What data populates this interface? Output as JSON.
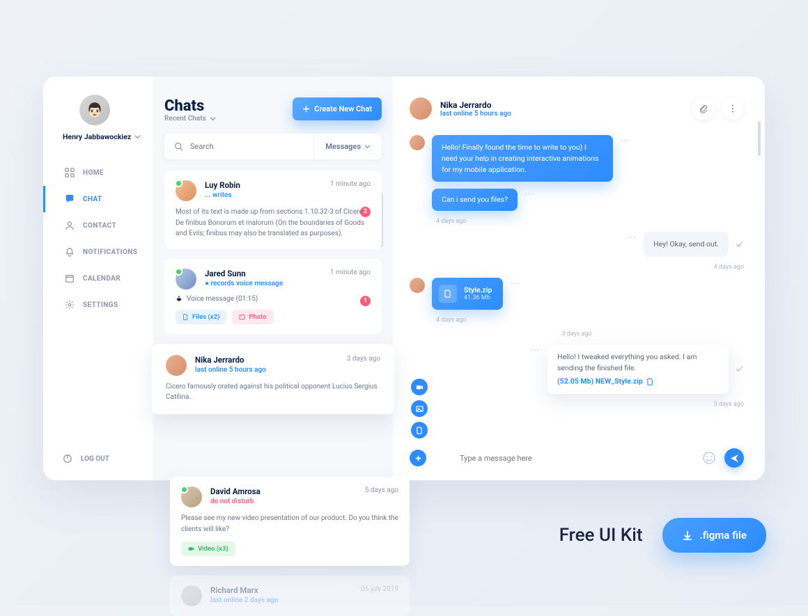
{
  "user": {
    "name": "Henry Jabbawockiez"
  },
  "nav": {
    "home": "HOME",
    "chat": "CHAT",
    "contact": "CONTACT",
    "notifications": "NOTIFICATIONS",
    "calendar": "CALENDAR",
    "settings": "SETTINGS",
    "logout": "LOG OUT"
  },
  "chats": {
    "title": "Chats",
    "recent": "Recent Chats",
    "new_chat": "Create New Chat",
    "search_placeholder": "Search",
    "filter": "Messages"
  },
  "list": {
    "c1": {
      "name": "Luy Robin",
      "status": "... writes",
      "time": "1 minute ago",
      "body": "Most of its text is made up from sections 1.10.32-3 of Cicero's De finibus Bonorum et malorum (On the boundaries of Goods and Evils; finibus may also be translated as purposes).",
      "badge": "2"
    },
    "c2": {
      "name": "Jared Sunn",
      "status": "● records voice message",
      "time": "1 minute ago",
      "voice": "Voice message (01:15)",
      "badge": "1",
      "chip_files": "Files (x2)",
      "chip_photo": "Photo"
    },
    "c3": {
      "name": "Nika Jerrardo",
      "status": "last online 5 hours ago",
      "time": "3 days ago",
      "body": "Cicero famously orated against his political opponent Lucius Sergius Catilina."
    },
    "c4": {
      "name": "David Amrosa",
      "status": "do not disturb",
      "time": "5 days ago",
      "body": "Please see my new video presentation of our product. Do you think the clients will like?",
      "chip_video": "Video (x3)"
    },
    "c5": {
      "name": "Richard Marx",
      "status": "last online 2 days ago",
      "time": "05 july 2019"
    }
  },
  "conv": {
    "name": "Nika Jerrardo",
    "sub": "last online 5 hours ago",
    "m1": "Hello! Finally found the time to write to you) I need your help in creating interactive animations for my mobile application.",
    "m2": "Can i send you files?",
    "t1": "4 days ago",
    "m3": "Hey! Okay, send out.",
    "t2": "4 days ago",
    "file_name": "Style.zip",
    "file_size": "41.36 Mb",
    "t3": "4 days ago",
    "day": "3 days ago",
    "m4": "Hello! I tweaked everything you asked. I am sending the finished file.",
    "new_file": "(52.05 Mb) NEW_Style.zip",
    "t4": "3 days ago",
    "compose_placeholder": "Type a message here"
  },
  "promo": {
    "text": "Free UI Kit",
    "button": ".figma file"
  }
}
